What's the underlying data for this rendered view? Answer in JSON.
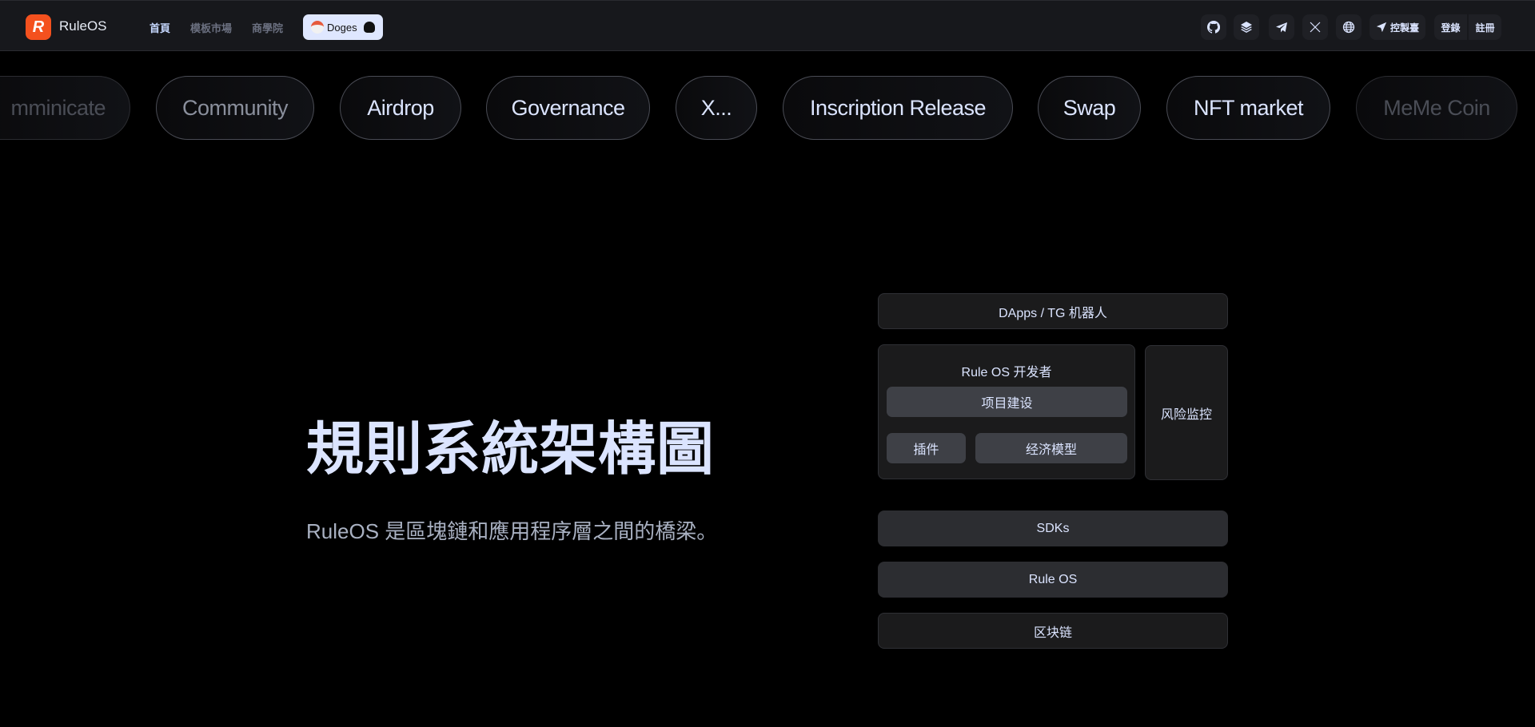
{
  "header": {
    "brand": "RuleOS",
    "logo_letter": "R",
    "nav": [
      {
        "label": "首頁",
        "active": true
      },
      {
        "label": "模板市場",
        "active": false
      },
      {
        "label": "商學院",
        "active": false
      }
    ],
    "doges_label": "Doges",
    "icons": [
      "github-icon",
      "layers-icon",
      "telegram-icon",
      "x-icon",
      "globe-icon"
    ],
    "console_label": "控製臺",
    "login_label": "登錄",
    "register_label": "註冊"
  },
  "marquee": {
    "items": [
      "Comminicate",
      "Community",
      "Airdrop",
      "Governance",
      "X...",
      "Inscription Release",
      "Swap",
      "NFT market",
      "MeMe Coin"
    ],
    "first_visible_partial": "mminicate"
  },
  "hero": {
    "title": "規則系統架構圖",
    "subtitle": "RuleOS 是區塊鏈和應用程序層之間的橋梁。"
  },
  "architecture": {
    "top": "DApps / TG 机器人",
    "developer_title": "Rule OS 开发者",
    "project": "项目建设",
    "plugin": "插件",
    "economy": "经济模型",
    "risk": "风险监控",
    "sdks": "SDKs",
    "ruleos": "Rule OS",
    "blockchain": "区块链"
  }
}
